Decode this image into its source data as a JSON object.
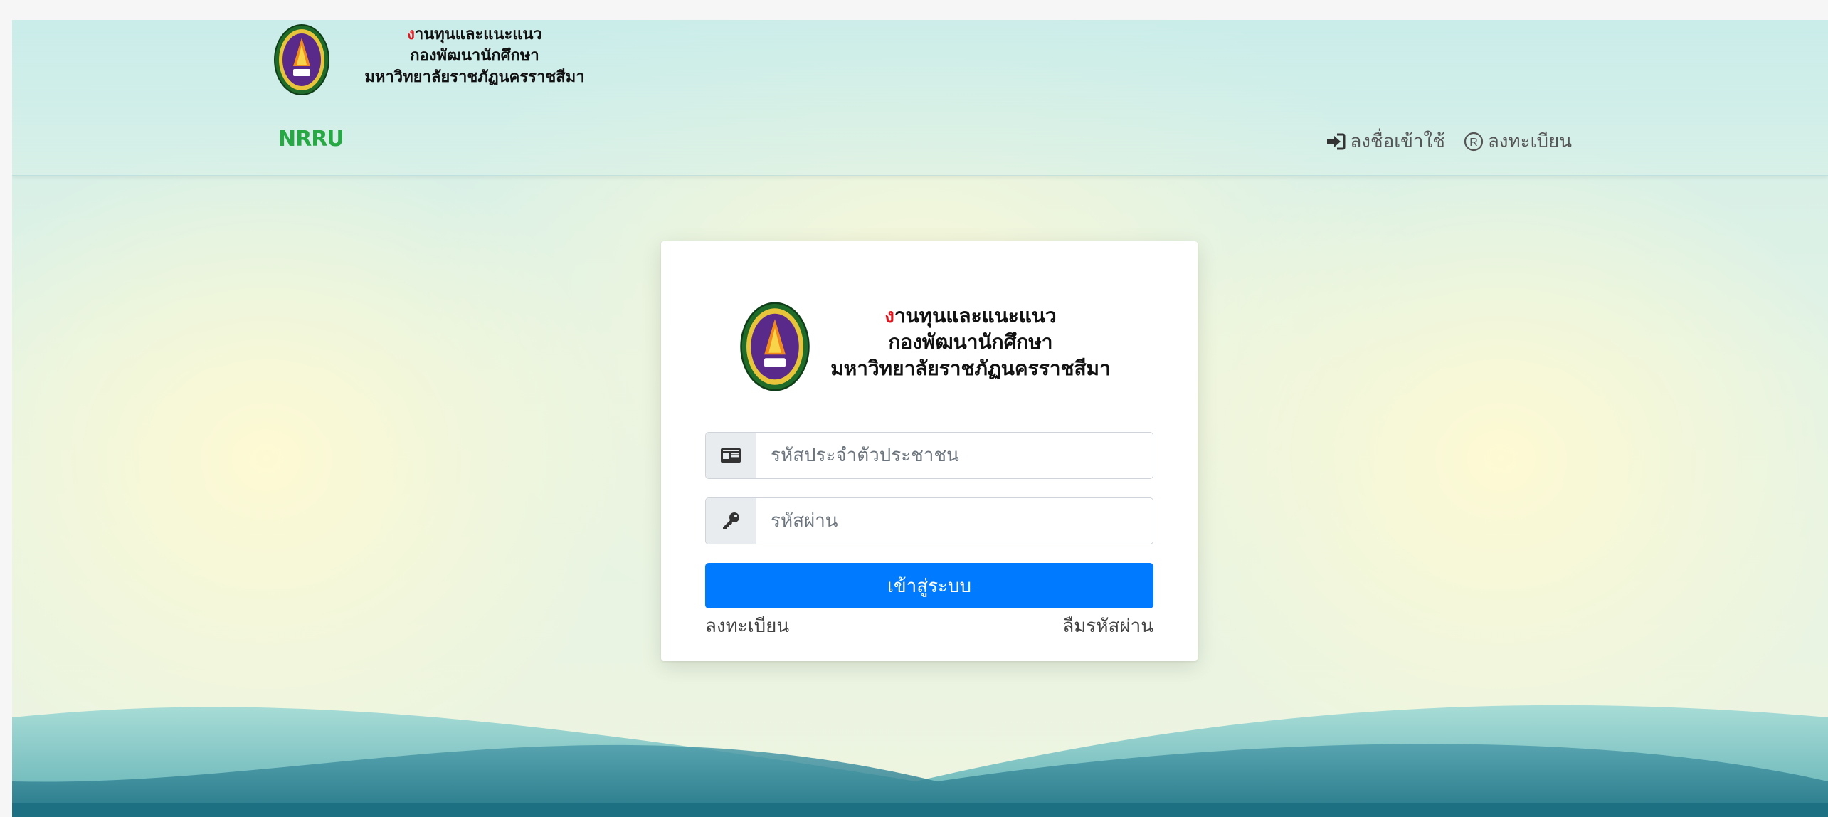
{
  "header": {
    "brand_lines": {
      "line1_first_letter": "ง",
      "line1_rest": "านทุนและแนะแนว",
      "line2": "กองพัฒนานักศึกษา",
      "line3": "มหาวิทยาลัยราชภัฏนครราชสีมา"
    },
    "nav_brand": "NRRU",
    "nav_links": {
      "login": "ลงชื่อเข้าใช้",
      "register": "ลงทะเบียน"
    }
  },
  "login_card": {
    "brand_lines": {
      "line1_first_letter": "ง",
      "line1_rest": "านทุนและแนะแนว",
      "line2": "กองพัฒนานักศึกษา",
      "line3": "มหาวิทยาลัยราชภัฏนครราชสีมา"
    },
    "id_field": {
      "placeholder": "รหัสประจำตัวประชาชน",
      "value": ""
    },
    "password_field": {
      "placeholder": "รหัสผ่าน",
      "value": ""
    },
    "submit_label": "เข้าสู่ระบบ",
    "register_link": "ลงทะเบียน",
    "forgot_link": "ลืมรหัสผ่าน"
  },
  "colors": {
    "accent_red": "#e3141b",
    "brand_green": "#28a745",
    "primary_button": "#007bff",
    "wave_dark": "#1d6f82",
    "wave_light": "#7fc6c4"
  },
  "icons": {
    "login": "sign-in-icon",
    "register": "registered-icon",
    "id_card": "id-card-icon",
    "password": "key-icon",
    "emblem": "university-emblem"
  }
}
